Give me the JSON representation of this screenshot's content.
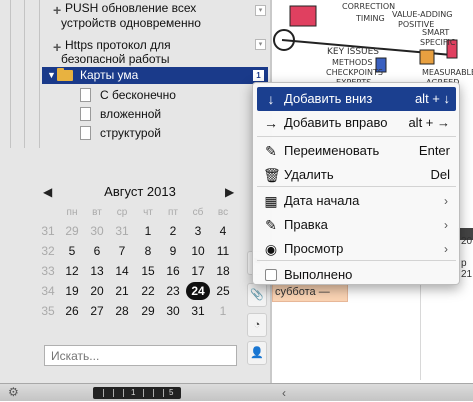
{
  "tree": {
    "items": [
      {
        "label": "PUSH обновление всех"
      },
      {
        "label": "устройств одновременно"
      },
      {
        "label": "Https протокол для"
      },
      {
        "label": "безопасной работы"
      }
    ],
    "selected": {
      "label": "Карты ума",
      "badge": "1"
    },
    "children": [
      {
        "label": "С бесконечно"
      },
      {
        "label": "вложенной"
      },
      {
        "label": "структурой"
      }
    ]
  },
  "calendar": {
    "prev": "◀",
    "next": "▶",
    "month": "Август 2013",
    "weekdays": [
      "пн",
      "вт",
      "ср",
      "чт",
      "пт",
      "сб",
      "вс"
    ],
    "weeks": [
      {
        "num": "31",
        "days": [
          "29",
          "30",
          "31",
          "1",
          "2",
          "3",
          "4"
        ]
      },
      {
        "num": "32",
        "days": [
          "5",
          "6",
          "7",
          "8",
          "9",
          "10",
          "11"
        ]
      },
      {
        "num": "33",
        "days": [
          "12",
          "13",
          "14",
          "15",
          "16",
          "17",
          "18"
        ]
      },
      {
        "num": "34",
        "days": [
          "19",
          "20",
          "21",
          "22",
          "23",
          "24",
          "25"
        ]
      },
      {
        "num": "35",
        "days": [
          "26",
          "27",
          "28",
          "29",
          "30",
          "31",
          "1"
        ]
      }
    ],
    "today": "24"
  },
  "search": {
    "placeholder": "Искать..."
  },
  "right_pane": {
    "art_labels": [
      "CORRECTION",
      "TIMING",
      "VALUE-ADDING",
      "POSITIVE",
      "KEY ISSUES",
      "METHODS",
      "CHECKPOINTS",
      "EXPERTS",
      "SMART",
      "SPECIFIC",
      "MEASURABLE",
      "AGREED"
    ],
    "event_line1": "",
    "event_line2": "суббота —",
    "num_20": "20",
    "num_21": "р 21"
  },
  "context_menu": {
    "items": [
      {
        "icon": "arrow-down-icon",
        "glyph": "↓",
        "label": "Добавить вниз",
        "shortcut": "alt + ↓",
        "active": true
      },
      {
        "icon": "arrow-right-icon",
        "glyph": "→",
        "label": "Добавить вправо",
        "shortcut": "alt + →"
      },
      {
        "icon": "pencil-icon",
        "glyph": "✎",
        "label": "Переименовать",
        "shortcut": "Enter"
      },
      {
        "icon": "trash-icon",
        "glyph": "🗑",
        "label": "Удалить",
        "shortcut": "Del"
      },
      {
        "icon": "calendar-icon",
        "glyph": "▦",
        "label": "Дата начала",
        "submenu": "›"
      },
      {
        "icon": "edit-icon",
        "glyph": "✎",
        "label": "Правка",
        "submenu": "›"
      },
      {
        "icon": "eye-icon",
        "glyph": "◉",
        "label": "Просмотр",
        "submenu": "›"
      },
      {
        "icon": "checkbox-icon",
        "glyph": "",
        "label": "Выполнено"
      }
    ]
  },
  "statusbar": {
    "zoom_labels": [
      "1",
      "5"
    ],
    "gear_glyph": "⚙",
    "arrow_glyph": "‹"
  }
}
